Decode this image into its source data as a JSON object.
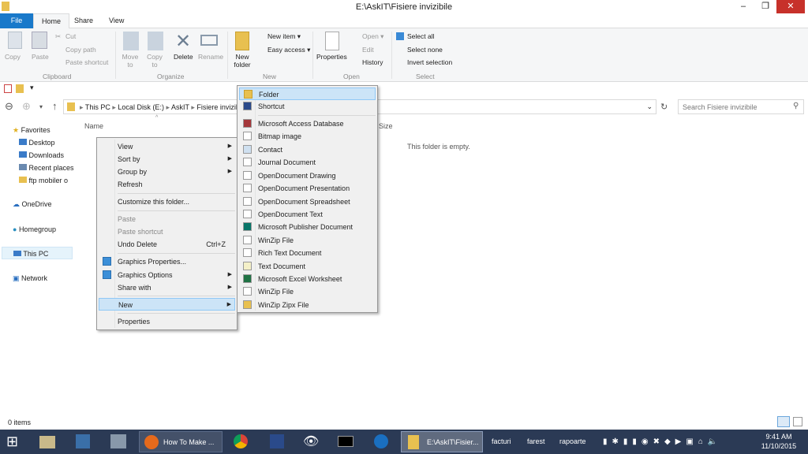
{
  "window": {
    "title": "E:\\AskIT\\Fisiere invizibile"
  },
  "tabs": [
    {
      "label": "File"
    },
    {
      "label": "Home"
    },
    {
      "label": "Share"
    },
    {
      "label": "View"
    }
  ],
  "ribbon": {
    "clipboard": {
      "group": "Clipboard",
      "copy": "Copy",
      "paste": "Paste",
      "cut": "Cut",
      "copy_path": "Copy path",
      "paste_shortcut": "Paste shortcut"
    },
    "organize": {
      "group": "Organize",
      "move_to": "Move to",
      "copy_to": "Copy to",
      "delete": "Delete",
      "rename": "Rename"
    },
    "new": {
      "group": "New",
      "new_folder": "New folder",
      "new_item": "New item ▾",
      "easy_access": "Easy access ▾"
    },
    "open": {
      "group": "Open",
      "properties": "Properties",
      "open": "Open ▾",
      "edit": "Edit",
      "history": "History"
    },
    "select": {
      "group": "Select",
      "select_all": "Select all",
      "select_none": "Select none",
      "invert": "Invert selection"
    }
  },
  "address": {
    "crumbs": [
      "This PC",
      "Local Disk (E:)",
      "AskIT",
      "Fisiere invizibile"
    ],
    "search_placeholder": "Search Fisiere invizibile"
  },
  "sidebar": {
    "items": [
      {
        "label": "Favorites"
      },
      {
        "label": "Desktop"
      },
      {
        "label": "Downloads"
      },
      {
        "label": "Recent places"
      },
      {
        "label": "ftp mobiler o"
      },
      {
        "label": "OneDrive"
      },
      {
        "label": "Homegroup"
      },
      {
        "label": "This PC"
      },
      {
        "label": "Network"
      }
    ]
  },
  "content": {
    "col_name": "Name",
    "col_size": "Size",
    "empty": "This folder is empty."
  },
  "context_menu": {
    "items": [
      {
        "label": "View"
      },
      {
        "label": "Sort by"
      },
      {
        "label": "Group by"
      },
      {
        "label": "Refresh"
      },
      {
        "label": "Customize this folder..."
      },
      {
        "label": "Paste"
      },
      {
        "label": "Paste shortcut"
      },
      {
        "label": "Undo Delete",
        "shortcut": "Ctrl+Z"
      },
      {
        "label": "Graphics Properties..."
      },
      {
        "label": "Graphics Options"
      },
      {
        "label": "Share with"
      },
      {
        "label": "New"
      },
      {
        "label": "Properties"
      }
    ]
  },
  "new_menu": {
    "items": [
      "Folder",
      "Shortcut",
      "Microsoft Access Database",
      "Bitmap image",
      "Contact",
      "Journal Document",
      "OpenDocument Drawing",
      "OpenDocument Presentation",
      "OpenDocument Spreadsheet",
      "OpenDocument Text",
      "Microsoft Publisher Document",
      "WinZip File",
      "Rich Text Document",
      "Text Document",
      "Microsoft Excel Worksheet",
      "WinZip File",
      "WinZip Zipx File"
    ]
  },
  "status": {
    "items": "0 items"
  },
  "taskbar": {
    "firefox": "How To Make ...",
    "explorer": "E:\\AskIT\\Fisier...",
    "toolbars": [
      "facturi",
      "farest",
      "rapoarte"
    ],
    "time": "9:41 AM",
    "date": "11/10/2015"
  }
}
